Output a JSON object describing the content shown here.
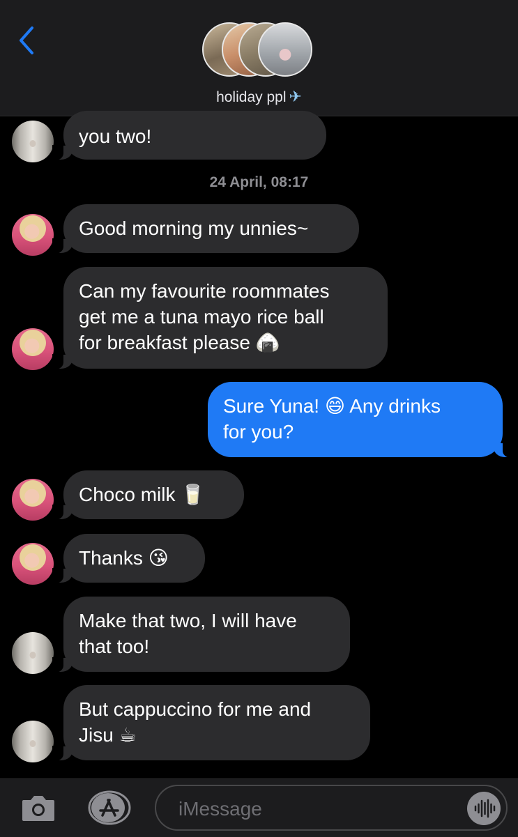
{
  "header": {
    "title": "holiday ppl",
    "title_icon": "airplane-icon",
    "back_icon": "chevron-left-icon",
    "accent": "#1f7af5"
  },
  "messages": [
    {
      "sender": "jennie",
      "direction": "incoming",
      "text": "you two!",
      "avatar": "hallway-photo"
    },
    {
      "type": "timestamp",
      "date": "24 April,",
      "time": "08:17"
    },
    {
      "sender": "yuna",
      "direction": "incoming",
      "text": "Good morning my unnies~",
      "avatar": "pink-photo"
    },
    {
      "sender": "yuna",
      "direction": "incoming",
      "text": "Can my favourite roommates\nget me a tuna mayo rice ball\nfor breakfast please 🍙",
      "avatar": "pink-photo"
    },
    {
      "sender": "me",
      "direction": "outgoing",
      "text": "Sure Yuna! 😄 Any drinks\nfor you?"
    },
    {
      "sender": "yuna",
      "direction": "incoming",
      "text": "Choco milk 🥛",
      "avatar": "pink-photo"
    },
    {
      "sender": "yuna",
      "direction": "incoming",
      "text": "Thanks 😘",
      "avatar": "pink-photo"
    },
    {
      "sender": "jennie",
      "direction": "incoming",
      "text": "Make that two, I will have\nthat too!",
      "avatar": "hallway-photo"
    },
    {
      "sender": "jennie",
      "direction": "incoming",
      "text": "But cappuccino for me and\nJisu ☕",
      "avatar": "hallway-photo"
    }
  ],
  "composer": {
    "placeholder": "iMessage",
    "camera_icon": "camera-icon",
    "apps_icon": "app-store-icon",
    "voice_icon": "waveform-icon"
  },
  "colors": {
    "incoming_bubble": "#2c2c2e",
    "outgoing_bubble": "#1f7af5",
    "background": "#000000",
    "bar": "#1c1c1e"
  }
}
